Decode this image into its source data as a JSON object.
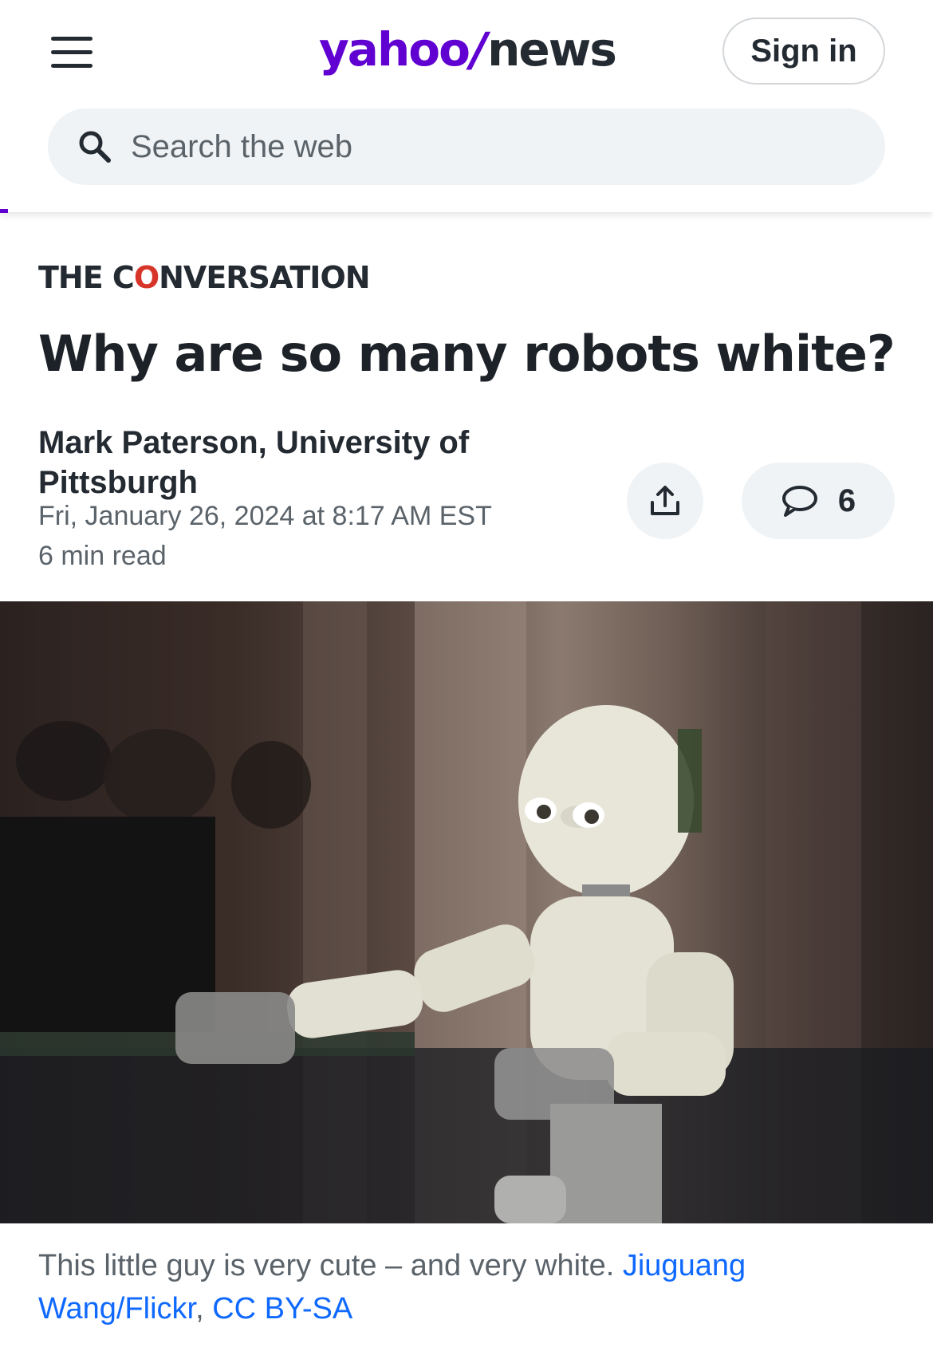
{
  "header": {
    "logo_brand": "yahoo",
    "logo_slash": "/",
    "logo_section": "news",
    "signin_label": "Sign in",
    "search_placeholder": "Search the web"
  },
  "article": {
    "provider_pre": "THE C",
    "provider_o": "O",
    "provider_post": "NVERSATION",
    "title": "Why are so many robots white?",
    "author": "Mark Paterson, University of Pittsburgh",
    "date": "Fri, January 26, 2024 at 8:17 AM EST",
    "read_time": "6 min read",
    "comment_count": "6"
  },
  "image": {
    "caption_text": "This little guy is very cute – and very white. ",
    "credit_link_1": "Jiuguang Wang/Flickr",
    "credit_separator": ", ",
    "credit_link_2": "CC BY-SA"
  },
  "colors": {
    "brand": "#6001d2",
    "link": "#0f69ff",
    "conversation_red": "#d8352a"
  }
}
